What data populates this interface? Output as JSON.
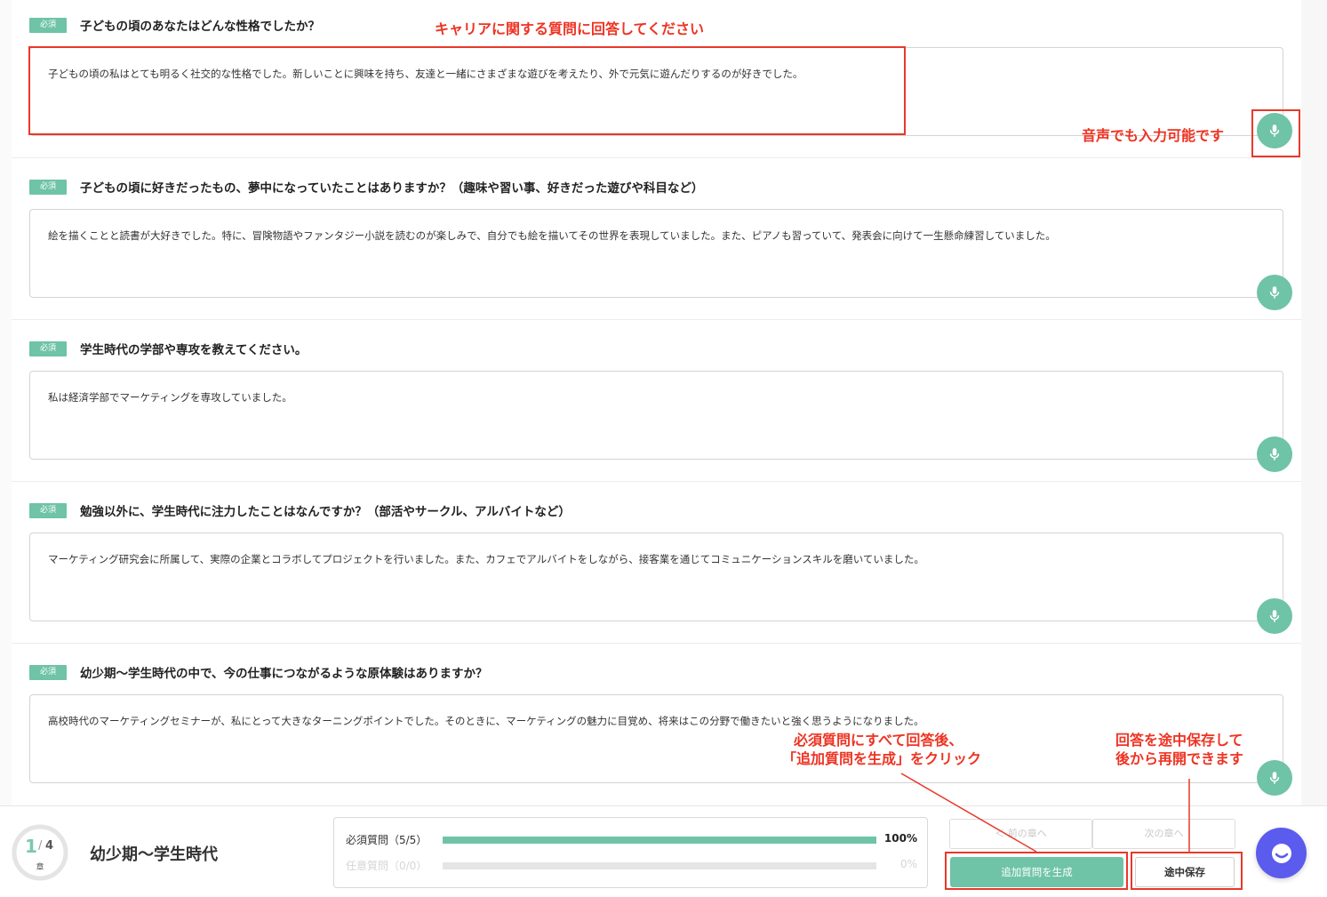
{
  "questions": [
    {
      "badge": "必須",
      "title": "子どもの頃のあなたはどんな性格でしたか？",
      "answer": "子どもの頃の私はとても明るく社交的な性格でした。新しいことに興味を持ち、友達と一緒にさまざまな遊びを考えたり、外で元気に遊んだりするのが好きでした。"
    },
    {
      "badge": "必須",
      "title": "子どもの頃に好きだったもの、夢中になっていたことはありますか？（趣味や習い事、好きだった遊びや科目など）",
      "answer": "絵を描くことと読書が大好きでした。特に、冒険物語やファンタジー小説を読むのが楽しみで、自分でも絵を描いてその世界を表現していました。また、ピアノも習っていて、発表会に向けて一生懸命練習していました。"
    },
    {
      "badge": "必須",
      "title": "学生時代の学部や専攻を教えてください。",
      "answer": "私は経済学部でマーケティングを専攻していました。"
    },
    {
      "badge": "必須",
      "title": "勉強以外に、学生時代に注力したことはなんですか？（部活やサークル、アルバイトなど）",
      "answer": "マーケティング研究会に所属して、実際の企業とコラボしてプロジェクトを行いました。また、カフェでアルバイトをしながら、接客業を通じてコミュニケーションスキルを磨いていました。"
    },
    {
      "badge": "必須",
      "title": "幼少期〜学生時代の中で、今の仕事につながるような原体験はありますか？",
      "answer": "高校時代のマーケティングセミナーが、私にとって大きなターニングポイントでした。そのときに、マーケティングの魅力に目覚め、将来はこの分野で働きたいと強く思うようになりました。"
    }
  ],
  "annotations": {
    "answer_hint": "キャリアに関する質問に回答してください",
    "voice_hint": "音声でも入力可能です",
    "generate_hint_line1": "必須質問にすべて回答後、",
    "generate_hint_line2": "「追加質問を生成」をクリック",
    "save_hint_line1": "回答を途中保存して",
    "save_hint_line2": "後から再開できます"
  },
  "footer": {
    "chapter_current": "1",
    "chapter_sep": "/",
    "chapter_total": "4",
    "chapter_unit": "章",
    "chapter_title": "幼少期〜学生時代",
    "required_label": "必須質問（5/5）",
    "required_percent": "100%",
    "required_fraction": 1.0,
    "optional_label": "任意質問（0/0）",
    "optional_percent": "0%",
    "optional_fraction": 0.0,
    "prev_label": "＜ 前の章へ",
    "next_label": "次の章へ",
    "generate_label": "追加質問を生成",
    "save_label": "途中保存"
  },
  "colors": {
    "accent": "#6fc3a7",
    "annotation": "#e8392a",
    "chat": "#5b5bee"
  },
  "icons": [
    "microphone-icon",
    "chat-icon"
  ]
}
